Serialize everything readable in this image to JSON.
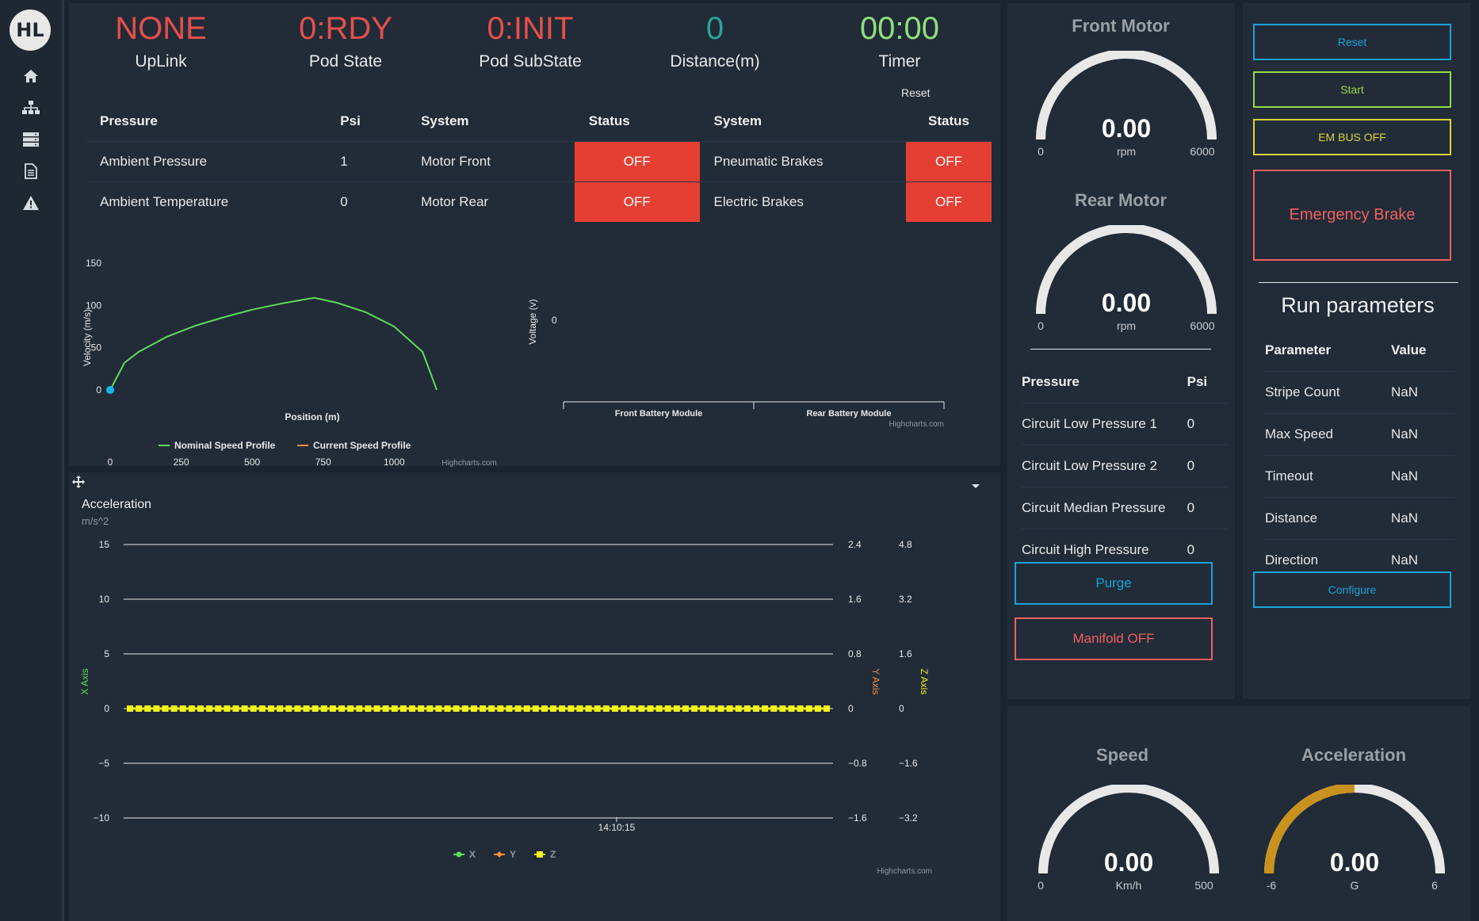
{
  "sidebar": {
    "logo_text": "HL",
    "items": [
      {
        "icon": "home-icon"
      },
      {
        "icon": "sitemap-icon"
      },
      {
        "icon": "server-icon"
      },
      {
        "icon": "document-icon"
      },
      {
        "icon": "warning-icon"
      }
    ]
  },
  "stats": [
    {
      "value": "NONE",
      "label": "UpLink",
      "color": "#e5504a"
    },
    {
      "value": "0:RDY",
      "label": "Pod State",
      "color": "#e5504a"
    },
    {
      "value": "0:INIT",
      "label": "Pod SubState",
      "color": "#e5504a"
    },
    {
      "value": "0",
      "label": "Distance(m)",
      "color": "#2aa39a"
    },
    {
      "value": "00:00",
      "label": "Timer",
      "color": "#8fe07a"
    }
  ],
  "timer_reset_label": "Reset",
  "status_table": {
    "headers": [
      "Pressure",
      "Psi",
      "System",
      "Status",
      "System",
      "Status"
    ],
    "rows": [
      [
        "Ambient Pressure",
        "1",
        "Motor Front",
        "OFF",
        "Pneumatic Brakes",
        "OFF"
      ],
      [
        "Ambient Temperature",
        "0",
        "Motor Rear",
        "OFF",
        "Electric Brakes",
        "OFF"
      ]
    ]
  },
  "chart_data": [
    {
      "type": "line",
      "title": "",
      "xlabel": "Position (m)",
      "ylabel": "Velocity (m/s)",
      "xlim": [
        0,
        1200
      ],
      "ylim": [
        0,
        150
      ],
      "xticks": [
        "0",
        "250",
        "500",
        "750",
        "1000"
      ],
      "yticks": [
        "0",
        "50",
        "100",
        "150"
      ],
      "series": [
        {
          "name": "Nominal Speed Profile",
          "color": "#5ddc5d",
          "x": [
            0,
            50,
            100,
            200,
            300,
            400,
            500,
            600,
            700,
            720,
            800,
            900,
            1000,
            1100,
            1150
          ],
          "y": [
            0,
            32,
            45,
            63,
            76,
            86,
            95,
            102,
            108,
            109,
            103,
            92,
            75,
            45,
            0
          ]
        },
        {
          "name": "Current Speed Profile",
          "color": "#f08b3c",
          "x": [
            0
          ],
          "y": [
            0
          ]
        }
      ],
      "credit": "Highcharts.com"
    },
    {
      "type": "bar",
      "title": "",
      "ylabel": "Voltage (v)",
      "categories": [
        "Front Battery Module",
        "Rear Battery Module"
      ],
      "values": [
        0,
        0
      ],
      "yticks": [
        "0"
      ],
      "credit": "Highcharts.com"
    },
    {
      "type": "line",
      "title": "Acceleration",
      "subtitle": "m/s^2",
      "xlabel": "",
      "x_tick": "14:10:15",
      "axes": {
        "x_axis": {
          "label": "X Axis",
          "ticks": [
            "15",
            "10",
            "5",
            "0",
            "−5",
            "−10"
          ],
          "ylim": [
            -10,
            15
          ]
        },
        "y_axis": {
          "label": "Y Axis",
          "ticks": [
            "2.4",
            "1.6",
            "0.8",
            "0",
            "−0.8",
            "−1.6"
          ]
        },
        "z_axis": {
          "label": "Z Axis",
          "ticks": [
            "4.8",
            "3.2",
            "1.6",
            "0",
            "−1.6",
            "−3.2"
          ]
        }
      },
      "series": [
        {
          "name": "X",
          "color": "#5ddc5d",
          "value": 0
        },
        {
          "name": "Y",
          "color": "#f08b3c",
          "value": 0
        },
        {
          "name": "Z",
          "color": "#f2f21a",
          "value": 0
        }
      ],
      "points": 80,
      "credit": "Highcharts.com"
    }
  ],
  "front_motor": {
    "title": "Front Motor",
    "value": "0.00",
    "unit": "rpm",
    "min": "0",
    "max": "6000",
    "fraction": 0
  },
  "rear_motor": {
    "title": "Rear Motor",
    "value": "0.00",
    "unit": "rpm",
    "min": "0",
    "max": "6000",
    "fraction": 0
  },
  "pressure_table": {
    "headers": [
      "Pressure",
      "Psi"
    ],
    "rows": [
      [
        "Circuit Low Pressure 1",
        "0"
      ],
      [
        "Circuit Low Pressure 2",
        "0"
      ],
      [
        "Circuit Median Pressure",
        "0"
      ],
      [
        "Circuit High Pressure",
        "0"
      ]
    ]
  },
  "purge_label": "Purge",
  "manifold_label": "Manifold OFF",
  "controls": {
    "reset": "Reset",
    "start": "Start",
    "em_bus": "EM BUS OFF",
    "emergency": "Emergency Brake",
    "configure": "Configure"
  },
  "run_params": {
    "title": "Run parameters",
    "headers": [
      "Parameter",
      "Value"
    ],
    "rows": [
      [
        "Stripe Count",
        "NaN"
      ],
      [
        "Max Speed",
        "NaN"
      ],
      [
        "Timeout",
        "NaN"
      ],
      [
        "Distance",
        "NaN"
      ],
      [
        "Direction",
        "NaN"
      ]
    ]
  },
  "speed_gauge": {
    "title": "Speed",
    "value": "0.00",
    "unit": "Km/h",
    "min": "0",
    "max": "500",
    "fraction": 0
  },
  "accel_gauge": {
    "title": "Acceleration",
    "value": "0.00",
    "unit": "G",
    "min": "-6",
    "max": "6",
    "fraction": 0.5,
    "color": "#c9921e"
  },
  "colors": {
    "off": "#e53f34",
    "background": "#1b2330",
    "panel": "#222b38"
  }
}
